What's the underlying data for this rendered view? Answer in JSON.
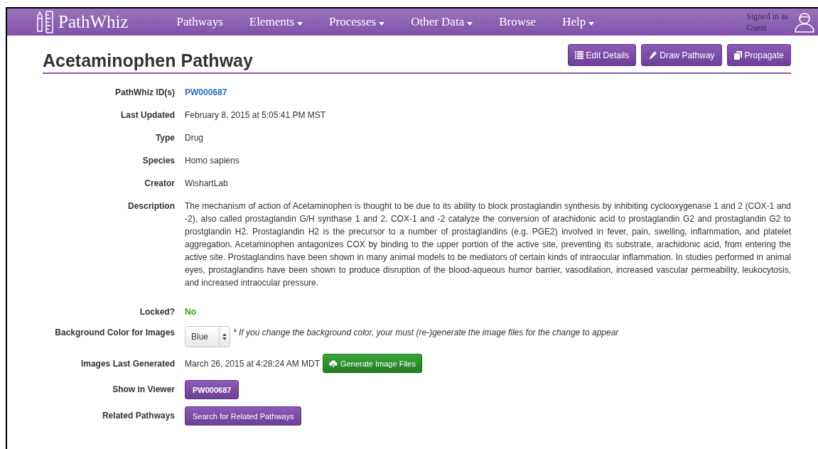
{
  "navbar": {
    "brand": "PathWhiz",
    "items": [
      {
        "label": "Pathways",
        "has_menu": false
      },
      {
        "label": "Elements",
        "has_menu": true
      },
      {
        "label": "Processes",
        "has_menu": true
      },
      {
        "label": "Other Data",
        "has_menu": true
      },
      {
        "label": "Browse",
        "has_menu": false
      },
      {
        "label": "Help",
        "has_menu": true
      }
    ],
    "user": {
      "line_1": "Signed in as",
      "line_2": "Guest"
    }
  },
  "page": {
    "title": "Acetaminophen Pathway",
    "actions": [
      {
        "label": "Edit Details"
      },
      {
        "label": "Draw Pathway"
      },
      {
        "label": "Propagate"
      }
    ]
  },
  "details": [
    {
      "kind": "link",
      "label": "PathWhiz ID(s)",
      "value": "PW000687"
    },
    {
      "kind": "text",
      "label": "Last Updated",
      "value": "February 8, 2015 at 5:05:41 PM MST"
    },
    {
      "kind": "text",
      "label": "Type",
      "value": "Drug"
    },
    {
      "kind": "text",
      "label": "Species",
      "value": "Homo sapiens"
    },
    {
      "kind": "text",
      "label": "Creator",
      "value": "WishartLab"
    },
    {
      "kind": "paragraph",
      "label": "Description",
      "value": "The mechanism of action of Acetaminophen is thought to be due to its ability to block prostaglandin synthesis by inhibiting cyclooxygenase 1 and 2 (COX-1 and -2), also called prostaglandin G/H synthase 1 and 2. COX-1 and -2 catalyze the conversion of arachidonic acid to prostaglandin G2 and prostaglandin G2 to prostglandin H2. Prostaglandin H2 is the precursor to a number of prostaglandins (e.g. PGE2) involved in fever, pain, swelling, inflammation, and platelet aggregation. Acetaminophen antagonizes COX by binding to the upper portion of the active site, preventing its substrate, arachidonic acid, from entering the active site. Prostaglandins have been shown in many animal models to be mediators of certain kinds of intraocular inflammation. In studies performed in animal eyes, prostaglandins have been shown to produce disruption of the blood-aqueous humor barrier, vasodilation, increased vascular permeability, leukocytosis, and increased intraocular pressure."
    },
    {
      "kind": "status",
      "label": "Locked?",
      "value": "No"
    },
    {
      "kind": "select",
      "label": "Background Color for Images",
      "value": "Blue",
      "note": "* If you change the background color, your must (re-)generate the image files for the change to appear"
    },
    {
      "kind": "generated",
      "label": "Images Last Generated",
      "value": "March 26, 2015 at 4:28:24 AM MDT",
      "button": "Generate Image Files"
    },
    {
      "kind": "button",
      "label": "Show in Viewer",
      "value": "PW000687",
      "bold": true
    },
    {
      "kind": "button",
      "label": "Related Pathways",
      "value": "Search for Related Pathways",
      "bold": false
    }
  ]
}
